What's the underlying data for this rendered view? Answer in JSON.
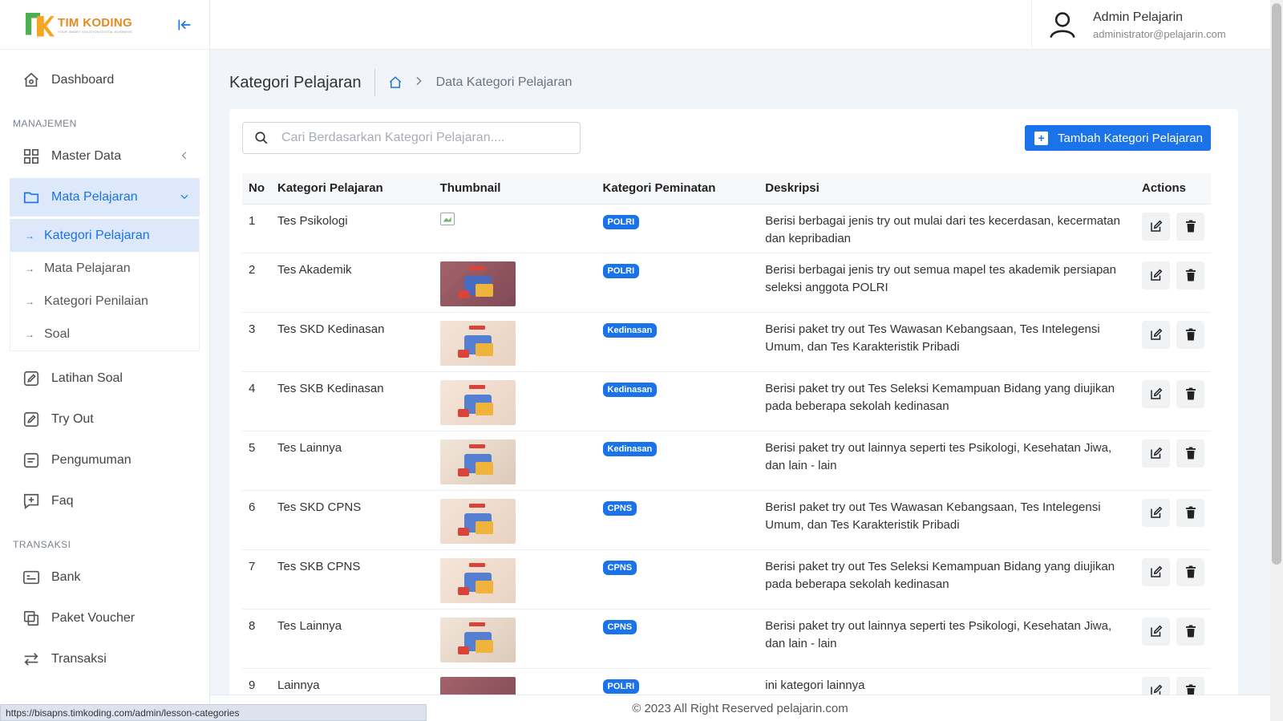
{
  "brand": {
    "name": "TIM KODING",
    "tagline": "YOUR SMART SOLUTION DIGITAL BUSINESS"
  },
  "sidebar": {
    "dashboard": "Dashboard",
    "section_manajemen": "MANAJEMEN",
    "master_data": "Master Data",
    "mata_pelajaran": "Mata Pelajaran",
    "submenu": [
      "Kategori Pelajaran",
      "Mata Pelajaran",
      "Kategori Penilaian",
      "Soal"
    ],
    "latihan_soal": "Latihan Soal",
    "try_out": "Try Out",
    "pengumuman": "Pengumuman",
    "faq": "Faq",
    "section_transaksi": "TRANSAKSI",
    "bank": "Bank",
    "paket_voucher": "Paket Voucher",
    "transaksi": "Transaksi"
  },
  "user": {
    "name": "Admin Pelajarin",
    "email": "administrator@pelajarin.com"
  },
  "page": {
    "title": "Kategori Pelajaran",
    "breadcrumb_current": "Data Kategori Pelajaran"
  },
  "search": {
    "placeholder": "Cari Berdasarkan Kategori Pelajaran...."
  },
  "add_button": "Tambah Kategori Pelajaran",
  "table": {
    "headers": [
      "No",
      "Kategori Pelajaran",
      "Thumbnail",
      "Kategori Peminatan",
      "Deskripsi",
      "Actions"
    ],
    "rows": [
      {
        "no": "1",
        "kategori": "Tes Psikologi",
        "peminatan": "POLRI",
        "deskripsi": "Berisi berbagai jenis try out mulai dari tes kecerdasan, kecermatan dan kepribadian"
      },
      {
        "no": "2",
        "kategori": "Tes Akademik",
        "peminatan": "POLRI",
        "deskripsi": "Berisi berbagai jenis try out semua mapel tes akademik persiapan seleksi anggota POLRI"
      },
      {
        "no": "3",
        "kategori": "Tes SKD Kedinasan",
        "peminatan": "Kedinasan",
        "deskripsi": "Berisi paket try out Tes Wawasan Kebangsaan, Tes Intelegensi Umum, dan Tes Karakteristik Pribadi"
      },
      {
        "no": "4",
        "kategori": "Tes SKB Kedinasan",
        "peminatan": "Kedinasan",
        "deskripsi": "Berisi paket try out Tes Seleksi Kemampuan Bidang yang diujikan pada beberapa sekolah kedinasan"
      },
      {
        "no": "5",
        "kategori": "Tes Lainnya",
        "peminatan": "Kedinasan",
        "deskripsi": "Berisi paket try out lainnya seperti tes Psikologi, Kesehatan Jiwa, dan lain - lain"
      },
      {
        "no": "6",
        "kategori": "Tes SKD CPNS",
        "peminatan": "CPNS",
        "deskripsi": "BerisI paket try out Tes Wawasan Kebangsaan, Tes Intelegensi Umum, dan Tes Karakteristik Pribadi"
      },
      {
        "no": "7",
        "kategori": "Tes SKB CPNS",
        "peminatan": "CPNS",
        "deskripsi": "Berisi paket try out Tes Seleksi Kemampuan Bidang yang diujikan pada beberapa sekolah kedinasan"
      },
      {
        "no": "8",
        "kategori": "Tes Lainnya",
        "peminatan": "CPNS",
        "deskripsi": "Berisi paket try out lainnya seperti tes Psikologi, Kesehatan Jiwa, dan lain - lain"
      },
      {
        "no": "9",
        "kategori": "Lainnya",
        "peminatan": "POLRI",
        "deskripsi": "ini kategori lainnya"
      }
    ]
  },
  "footer": "© 2023 All Right Reserved pelajarin.com",
  "status_url": "https://bisapns.timkoding.com/admin/lesson-categories",
  "colors": {
    "primary": "#1a73e8",
    "active_bg": "#dde8fb",
    "page_bg": "#f1f4f9"
  }
}
